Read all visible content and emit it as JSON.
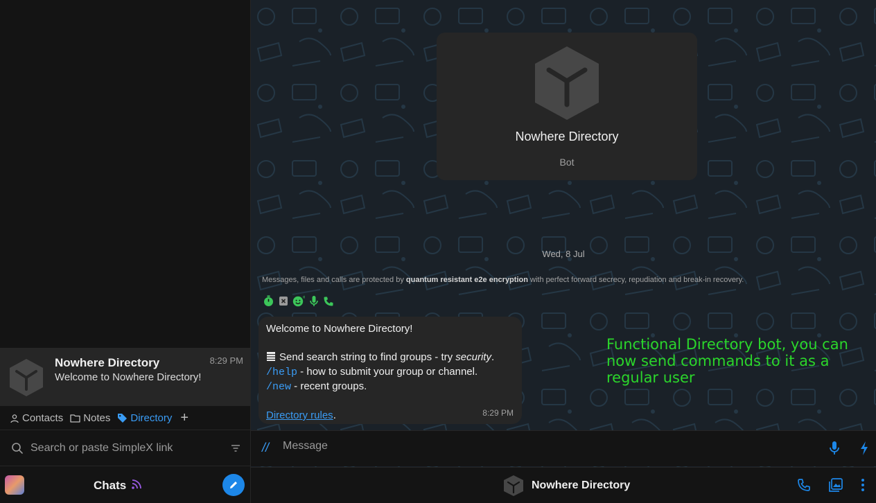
{
  "sidebar": {
    "chat": {
      "name": "Nowhere Directory",
      "time": "8:29 PM",
      "preview": "Welcome to Nowhere Directory!"
    },
    "tags": [
      {
        "label": "Contacts",
        "icon": "person-icon"
      },
      {
        "label": "Notes",
        "icon": "folder-icon"
      },
      {
        "label": "Directory",
        "icon": "tag-icon",
        "active": true
      }
    ],
    "search_placeholder": "Search or paste SimpleX link",
    "bottom_title": "Chats"
  },
  "chat": {
    "profile": {
      "name": "Nowhere Directory",
      "type": "Bot"
    },
    "date": "Wed, 8 Jul",
    "e2e": {
      "prefix": "Messages, files and calls are protected by ",
      "bold": "quantum resistant e2e encryption",
      "suffix": " with perfect forward secrecy, repudiation and break-in recovery."
    },
    "message": {
      "line1": "Welcome to Nowhere Directory!",
      "line2_text": "Send search string to find groups - try ",
      "line2_italic": "security",
      "line2_end": ".",
      "help_cmd": "/help",
      "help_text": " - how to submit your group or channel.",
      "new_cmd": "/new",
      "new_text": " - recent groups.",
      "rules_link": "Directory rules",
      "rules_end": ".",
      "time": "8:29 PM"
    },
    "annotation": "Functional Directory bot, you can now send commands to it as a regular user",
    "composer": {
      "slash": "//",
      "placeholder": "Message"
    },
    "header": {
      "name": "Nowhere Directory"
    }
  },
  "colors": {
    "accent": "#1d87e8",
    "link": "#3a9cf5",
    "feature_green": "#3cc65a",
    "annotation": "#2bd62b"
  }
}
